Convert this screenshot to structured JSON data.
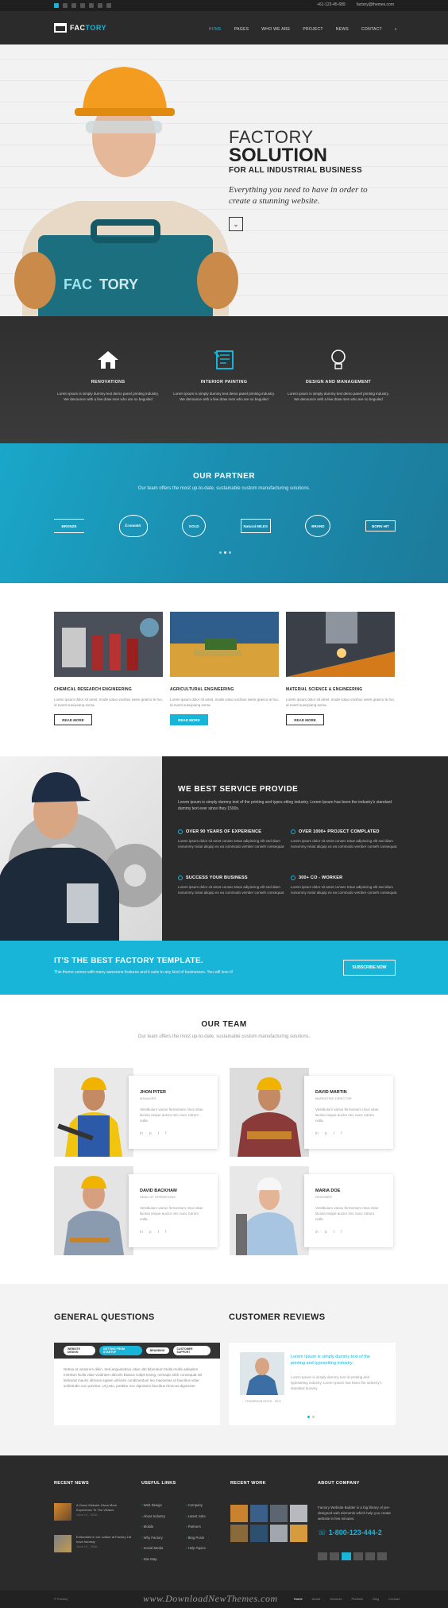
{
  "topbar": {
    "phone": "+61-123-45-689",
    "email": "factory@themes.com"
  },
  "logo": {
    "text_a": "FAC",
    "text_b": "TORY"
  },
  "nav": {
    "items": [
      "HOME",
      "PAGES",
      "WHO WE ARE",
      "PROJECT",
      "NEWS",
      "CONTACT"
    ]
  },
  "hero": {
    "title1": "FACTORY",
    "title2": "SOLUTION",
    "title3": "FOR ALL INDUSTRIAL BUSINESS",
    "tagline": "Everything you need to have in order to create a stunning website.",
    "box_a": "FAC",
    "box_b": "TORY"
  },
  "services": [
    {
      "title": "RENOVATIONS",
      "desc": "Lorem ipsum is simply dummy text demo panel printing industry. We denounce with a few draw men who are so beguiled"
    },
    {
      "title": "INTERIOR PAINTING",
      "desc": "Lorem ipsum is simply dummy text demo panel printing industry. We denounce with a few draw men who are so beguiled"
    },
    {
      "title": "DESIGN AND MANAGEMENT",
      "desc": "Lorem ipsum is simply dummy text demo panel printing industry. We denounce with a few draw men who are so beguiled"
    }
  ],
  "partner": {
    "title": "OUR PARTNER",
    "subtitle": "Our team offers the most up-to-date, sustainable custom manufacturing solutions.",
    "logos": [
      "BRONZE",
      "Economic",
      "GOLD",
      "Natural MILES",
      "BRAND",
      "BORN HIT"
    ]
  },
  "cards": [
    {
      "title": "CHEMICAL RESEARCH ENGINEERING",
      "desc": "Lorem ipsum dolor sit amet, mode soluo vocibus iveim graeco te hui, id everti suscipiunq exma.",
      "btn": "READ MORE"
    },
    {
      "title": "AGRICULTURAL ENGINEERING",
      "desc": "Lorem ipsum dolor sit amet, mode soluo vocibus iveim graeco te hui, id everti suscipiunq exma.",
      "btn": "READ MORE"
    },
    {
      "title": "MATERIAL SCIENCE & ENGINEERING",
      "desc": "Lorem ipsum dolor sit amet, mode soluo vocibus iveim graeco te hui, id everti suscipiunq exma.",
      "btn": "READ MORE"
    }
  ],
  "why": {
    "title": "WE BEST SERVICE PROVIDE",
    "intro": "Lorem ipsum is simply dummy text of the printing and types etting industry. Lorem Ipsum has been the industry's standard dummy text ever since they 1500s.",
    "features": [
      {
        "title": "OVER 90 YEARS OF EXPERIENCE",
        "desc": "Lorem ipsum dolor sit amet consec tetue adipiscing elit sed diam nonummy nisiut aliquip ex ea commodo vember conseh consequat."
      },
      {
        "title": "OVER 1000+ PROJECT COMPLATED",
        "desc": "Lorem ipsum dolor sit amet consec tetue adipiscing elit sed diam nonummy nisiut aliquip ex ea commodo vember conseh consequat."
      },
      {
        "title": "SUCCESS YOUR BUSINESS",
        "desc": "Lorem ipsum dolor sit amet consec tetue adipiscing elit sed diam nonummy nisiut aliquip ex ea commodo vember conseh consequat."
      },
      {
        "title": "300+ CO - WORKER",
        "desc": "Lorem ipsum dolor sit amet consec tetue adipiscing elit sed diam nonummy nisiut aliquip ex ea commodo vember conseh consequat."
      }
    ]
  },
  "cta": {
    "title": "IT'S THE BEST FACTORY TEMPLATE.",
    "desc": "This theme comes with many awesome features and it suits to any kind of businesses. You will love it!",
    "btn": "SUBSCRIBE NOW"
  },
  "team": {
    "title": "OUR TEAM",
    "subtitle": "Our team offers the most up-to-date, sustainable custom manufacturing solutions.",
    "members": [
      {
        "name": "JHON PITER",
        "role": "MANAGER",
        "desc": "Vestibulum varius fermentum risus vitae lacinia neque auctor nec nunc rutrum nulla."
      },
      {
        "name": "DAVID MARTIN",
        "role": "MARKETING DIRECTOR",
        "desc": "Vestibulum varius fermentum risus vitae lacinia neque auctor nec nunc rutrum nulla."
      },
      {
        "name": "DAVID BACKHAM",
        "role": "HEAD OF OPERATIONS",
        "desc": "Vestibulum varius fermentum risus vitae lacinia neque auctor nec nunc rutrum nulla."
      },
      {
        "name": "MARIA DOE",
        "role": "DESIGNER",
        "desc": "Vestibulum varius fermentum risus vitae lacinia neque auctor nec nunc rutrum nulla."
      }
    ]
  },
  "faq": {
    "title": "GENERAL QUESTIONS",
    "tabs": [
      "WEBSITE DESIGN",
      "GETTING FROM STARTUP",
      "BRANDING",
      "CUSTOMER SUPPORT"
    ],
    "text": "Nebsa at umasrum delin, Sed anguandrius vitae ultri bibendum Nulla mollis adiepites mimilum Nulla vitae vivalntee ultricels Etaeus nolipit tesing, nemaqis nibh consequat sel leiticerat mauris ultricies sapien ultrictes condimentum leo maecenas ut faucibus vitae sollicitudin orci pulvinar. Ut justo, porttitor nec dignissim faucibus rhoncus dignissim."
  },
  "reviews": {
    "title": "CUSTOMER REVIEWS",
    "quote": "Lorem Ipsum is simply dummy text of the printing and typesetting industry.",
    "text": "Lorem Ipsum is simply dummy text of printing and typesetting industry. Lorem Ipsum has been the industry's standard dummy.",
    "name": "- THOMPSON ROSS - CEO"
  },
  "footer": {
    "cols": [
      "RECENT NEWS",
      "USEFUL LINKS",
      "RECENT WORK",
      "ABOUT COMPANY"
    ],
    "news": [
      {
        "title": "A Clean Website Gives More Experience To The Visitors",
        "date": "June 14 , 2016"
      },
      {
        "title": "Embedded in our culture at Factory Ltd have honesty",
        "date": "June 14 , 2016"
      }
    ],
    "links1": [
      "Web Design",
      "About Industry",
      "Mobile",
      "Why Factory",
      "Social Media",
      "Site Map"
    ],
    "links2": [
      "Company",
      "Latest Jobs",
      "Partners",
      "Blog Posts",
      "Help Topics"
    ],
    "about": "Factory Website Builder is a big library of pre-designed web elements which help you create website in few minutes.",
    "phone": "1-800-123-444-2"
  },
  "bottom": {
    "copyright": "© Factory",
    "links": [
      "Home",
      "About",
      "Services",
      "Portfolio",
      "Blog",
      "Contact"
    ]
  },
  "watermark": "www.DownloadNewThemes.com",
  "colors": {
    "accent": "#19b5d8",
    "dark": "#2b2b2b"
  }
}
